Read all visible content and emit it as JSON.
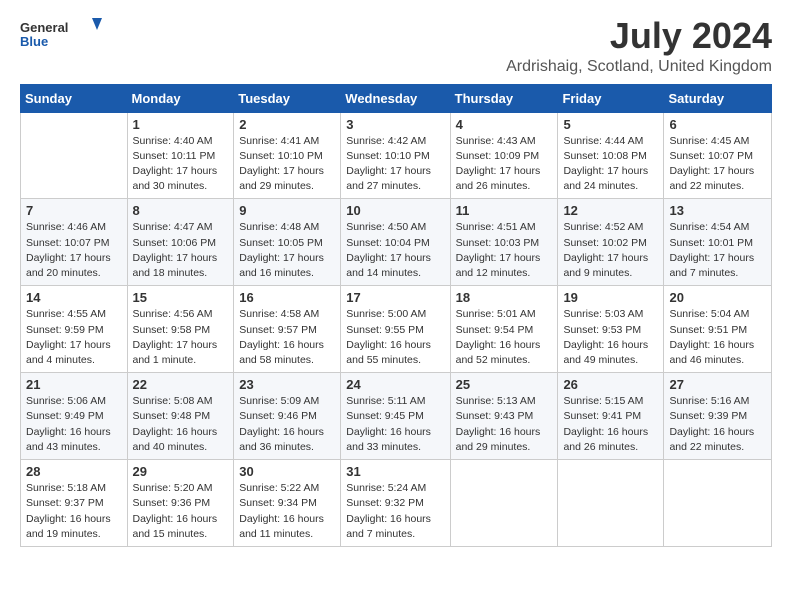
{
  "logo": {
    "general": "General",
    "blue": "Blue"
  },
  "title": "July 2024",
  "location": "Ardrishaig, Scotland, United Kingdom",
  "days_of_week": [
    "Sunday",
    "Monday",
    "Tuesday",
    "Wednesday",
    "Thursday",
    "Friday",
    "Saturday"
  ],
  "weeks": [
    [
      {
        "day": "",
        "sunrise": "",
        "sunset": "",
        "daylight": ""
      },
      {
        "day": "1",
        "sunrise": "Sunrise: 4:40 AM",
        "sunset": "Sunset: 10:11 PM",
        "daylight": "Daylight: 17 hours and 30 minutes."
      },
      {
        "day": "2",
        "sunrise": "Sunrise: 4:41 AM",
        "sunset": "Sunset: 10:10 PM",
        "daylight": "Daylight: 17 hours and 29 minutes."
      },
      {
        "day": "3",
        "sunrise": "Sunrise: 4:42 AM",
        "sunset": "Sunset: 10:10 PM",
        "daylight": "Daylight: 17 hours and 27 minutes."
      },
      {
        "day": "4",
        "sunrise": "Sunrise: 4:43 AM",
        "sunset": "Sunset: 10:09 PM",
        "daylight": "Daylight: 17 hours and 26 minutes."
      },
      {
        "day": "5",
        "sunrise": "Sunrise: 4:44 AM",
        "sunset": "Sunset: 10:08 PM",
        "daylight": "Daylight: 17 hours and 24 minutes."
      },
      {
        "day": "6",
        "sunrise": "Sunrise: 4:45 AM",
        "sunset": "Sunset: 10:07 PM",
        "daylight": "Daylight: 17 hours and 22 minutes."
      }
    ],
    [
      {
        "day": "7",
        "sunrise": "Sunrise: 4:46 AM",
        "sunset": "Sunset: 10:07 PM",
        "daylight": "Daylight: 17 hours and 20 minutes."
      },
      {
        "day": "8",
        "sunrise": "Sunrise: 4:47 AM",
        "sunset": "Sunset: 10:06 PM",
        "daylight": "Daylight: 17 hours and 18 minutes."
      },
      {
        "day": "9",
        "sunrise": "Sunrise: 4:48 AM",
        "sunset": "Sunset: 10:05 PM",
        "daylight": "Daylight: 17 hours and 16 minutes."
      },
      {
        "day": "10",
        "sunrise": "Sunrise: 4:50 AM",
        "sunset": "Sunset: 10:04 PM",
        "daylight": "Daylight: 17 hours and 14 minutes."
      },
      {
        "day": "11",
        "sunrise": "Sunrise: 4:51 AM",
        "sunset": "Sunset: 10:03 PM",
        "daylight": "Daylight: 17 hours and 12 minutes."
      },
      {
        "day": "12",
        "sunrise": "Sunrise: 4:52 AM",
        "sunset": "Sunset: 10:02 PM",
        "daylight": "Daylight: 17 hours and 9 minutes."
      },
      {
        "day": "13",
        "sunrise": "Sunrise: 4:54 AM",
        "sunset": "Sunset: 10:01 PM",
        "daylight": "Daylight: 17 hours and 7 minutes."
      }
    ],
    [
      {
        "day": "14",
        "sunrise": "Sunrise: 4:55 AM",
        "sunset": "Sunset: 9:59 PM",
        "daylight": "Daylight: 17 hours and 4 minutes."
      },
      {
        "day": "15",
        "sunrise": "Sunrise: 4:56 AM",
        "sunset": "Sunset: 9:58 PM",
        "daylight": "Daylight: 17 hours and 1 minute."
      },
      {
        "day": "16",
        "sunrise": "Sunrise: 4:58 AM",
        "sunset": "Sunset: 9:57 PM",
        "daylight": "Daylight: 16 hours and 58 minutes."
      },
      {
        "day": "17",
        "sunrise": "Sunrise: 5:00 AM",
        "sunset": "Sunset: 9:55 PM",
        "daylight": "Daylight: 16 hours and 55 minutes."
      },
      {
        "day": "18",
        "sunrise": "Sunrise: 5:01 AM",
        "sunset": "Sunset: 9:54 PM",
        "daylight": "Daylight: 16 hours and 52 minutes."
      },
      {
        "day": "19",
        "sunrise": "Sunrise: 5:03 AM",
        "sunset": "Sunset: 9:53 PM",
        "daylight": "Daylight: 16 hours and 49 minutes."
      },
      {
        "day": "20",
        "sunrise": "Sunrise: 5:04 AM",
        "sunset": "Sunset: 9:51 PM",
        "daylight": "Daylight: 16 hours and 46 minutes."
      }
    ],
    [
      {
        "day": "21",
        "sunrise": "Sunrise: 5:06 AM",
        "sunset": "Sunset: 9:49 PM",
        "daylight": "Daylight: 16 hours and 43 minutes."
      },
      {
        "day": "22",
        "sunrise": "Sunrise: 5:08 AM",
        "sunset": "Sunset: 9:48 PM",
        "daylight": "Daylight: 16 hours and 40 minutes."
      },
      {
        "day": "23",
        "sunrise": "Sunrise: 5:09 AM",
        "sunset": "Sunset: 9:46 PM",
        "daylight": "Daylight: 16 hours and 36 minutes."
      },
      {
        "day": "24",
        "sunrise": "Sunrise: 5:11 AM",
        "sunset": "Sunset: 9:45 PM",
        "daylight": "Daylight: 16 hours and 33 minutes."
      },
      {
        "day": "25",
        "sunrise": "Sunrise: 5:13 AM",
        "sunset": "Sunset: 9:43 PM",
        "daylight": "Daylight: 16 hours and 29 minutes."
      },
      {
        "day": "26",
        "sunrise": "Sunrise: 5:15 AM",
        "sunset": "Sunset: 9:41 PM",
        "daylight": "Daylight: 16 hours and 26 minutes."
      },
      {
        "day": "27",
        "sunrise": "Sunrise: 5:16 AM",
        "sunset": "Sunset: 9:39 PM",
        "daylight": "Daylight: 16 hours and 22 minutes."
      }
    ],
    [
      {
        "day": "28",
        "sunrise": "Sunrise: 5:18 AM",
        "sunset": "Sunset: 9:37 PM",
        "daylight": "Daylight: 16 hours and 19 minutes."
      },
      {
        "day": "29",
        "sunrise": "Sunrise: 5:20 AM",
        "sunset": "Sunset: 9:36 PM",
        "daylight": "Daylight: 16 hours and 15 minutes."
      },
      {
        "day": "30",
        "sunrise": "Sunrise: 5:22 AM",
        "sunset": "Sunset: 9:34 PM",
        "daylight": "Daylight: 16 hours and 11 minutes."
      },
      {
        "day": "31",
        "sunrise": "Sunrise: 5:24 AM",
        "sunset": "Sunset: 9:32 PM",
        "daylight": "Daylight: 16 hours and 7 minutes."
      },
      {
        "day": "",
        "sunrise": "",
        "sunset": "",
        "daylight": ""
      },
      {
        "day": "",
        "sunrise": "",
        "sunset": "",
        "daylight": ""
      },
      {
        "day": "",
        "sunrise": "",
        "sunset": "",
        "daylight": ""
      }
    ]
  ]
}
